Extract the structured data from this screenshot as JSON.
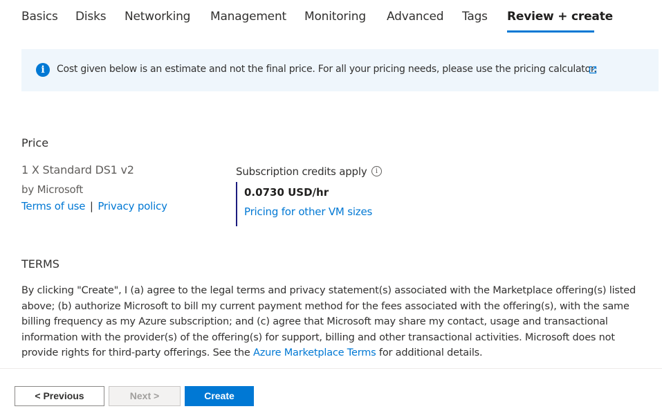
{
  "tabs": [
    {
      "label": "Basics"
    },
    {
      "label": "Disks"
    },
    {
      "label": "Networking"
    },
    {
      "label": "Management"
    },
    {
      "label": "Monitoring"
    },
    {
      "label": "Advanced"
    },
    {
      "label": "Tags"
    },
    {
      "label": "Review + create",
      "active": true
    }
  ],
  "info_bar": {
    "text": "Cost given below is an estimate and not the final price. For all your pricing needs, please use the pricing calculator.",
    "icon": "info-icon",
    "link_icon": "external-link-icon"
  },
  "price": {
    "title": "Price",
    "product_name": "1 X Standard DS1 v2",
    "publisher": "by Microsoft",
    "terms_of_use": "Terms of use",
    "separator": "|",
    "privacy_policy": "Privacy policy",
    "credits_label": "Subscription credits apply",
    "value": "0.0730 USD/hr",
    "other_sizes_link": "Pricing for other VM sizes"
  },
  "terms": {
    "title": "TERMS",
    "body_before_link": "By clicking \"Create\", I (a) agree to the legal terms and privacy statement(s) associated with the Marketplace offering(s) listed above; (b) authorize Microsoft to bill my current payment method for the fees associated with the offering(s), with the same billing frequency as my Azure subscription; and (c) agree that Microsoft may share my contact, usage and transactional information with the provider(s) of the offering(s) for support, billing and other transactional activities. Microsoft does not provide rights for third-party offerings. See the ",
    "link": "Azure Marketplace Terms",
    "body_after_link": " for additional details."
  },
  "footer": {
    "previous_label": "< Previous",
    "next_label": "Next >",
    "create_label": "Create"
  },
  "colors": {
    "accent": "#0078d4",
    "info_background": "#eff6fc",
    "price_border": "#1b1b7e"
  }
}
